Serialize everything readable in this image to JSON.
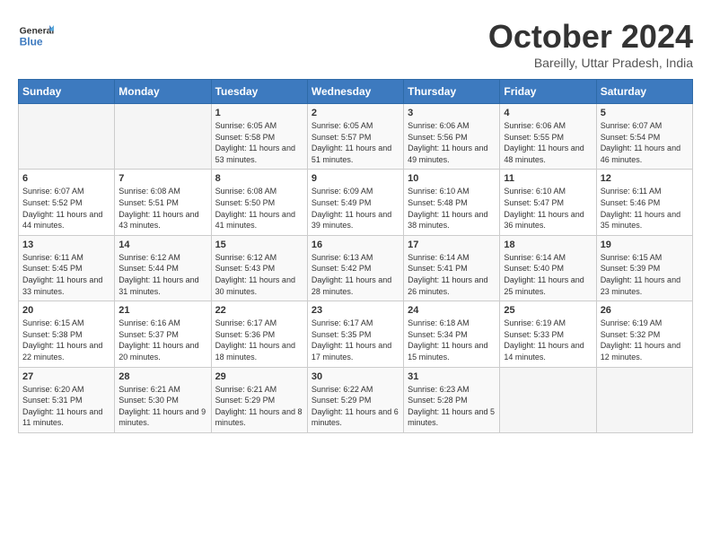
{
  "header": {
    "logo_text_general": "General",
    "logo_text_blue": "Blue",
    "month_title": "October 2024",
    "subtitle": "Bareilly, Uttar Pradesh, India"
  },
  "days_of_week": [
    "Sunday",
    "Monday",
    "Tuesday",
    "Wednesday",
    "Thursday",
    "Friday",
    "Saturday"
  ],
  "weeks": [
    [
      {
        "day": "",
        "sunrise": "",
        "sunset": "",
        "daylight": ""
      },
      {
        "day": "",
        "sunrise": "",
        "sunset": "",
        "daylight": ""
      },
      {
        "day": "1",
        "sunrise": "Sunrise: 6:05 AM",
        "sunset": "Sunset: 5:58 PM",
        "daylight": "Daylight: 11 hours and 53 minutes."
      },
      {
        "day": "2",
        "sunrise": "Sunrise: 6:05 AM",
        "sunset": "Sunset: 5:57 PM",
        "daylight": "Daylight: 11 hours and 51 minutes."
      },
      {
        "day": "3",
        "sunrise": "Sunrise: 6:06 AM",
        "sunset": "Sunset: 5:56 PM",
        "daylight": "Daylight: 11 hours and 49 minutes."
      },
      {
        "day": "4",
        "sunrise": "Sunrise: 6:06 AM",
        "sunset": "Sunset: 5:55 PM",
        "daylight": "Daylight: 11 hours and 48 minutes."
      },
      {
        "day": "5",
        "sunrise": "Sunrise: 6:07 AM",
        "sunset": "Sunset: 5:54 PM",
        "daylight": "Daylight: 11 hours and 46 minutes."
      }
    ],
    [
      {
        "day": "6",
        "sunrise": "Sunrise: 6:07 AM",
        "sunset": "Sunset: 5:52 PM",
        "daylight": "Daylight: 11 hours and 44 minutes."
      },
      {
        "day": "7",
        "sunrise": "Sunrise: 6:08 AM",
        "sunset": "Sunset: 5:51 PM",
        "daylight": "Daylight: 11 hours and 43 minutes."
      },
      {
        "day": "8",
        "sunrise": "Sunrise: 6:08 AM",
        "sunset": "Sunset: 5:50 PM",
        "daylight": "Daylight: 11 hours and 41 minutes."
      },
      {
        "day": "9",
        "sunrise": "Sunrise: 6:09 AM",
        "sunset": "Sunset: 5:49 PM",
        "daylight": "Daylight: 11 hours and 39 minutes."
      },
      {
        "day": "10",
        "sunrise": "Sunrise: 6:10 AM",
        "sunset": "Sunset: 5:48 PM",
        "daylight": "Daylight: 11 hours and 38 minutes."
      },
      {
        "day": "11",
        "sunrise": "Sunrise: 6:10 AM",
        "sunset": "Sunset: 5:47 PM",
        "daylight": "Daylight: 11 hours and 36 minutes."
      },
      {
        "day": "12",
        "sunrise": "Sunrise: 6:11 AM",
        "sunset": "Sunset: 5:46 PM",
        "daylight": "Daylight: 11 hours and 35 minutes."
      }
    ],
    [
      {
        "day": "13",
        "sunrise": "Sunrise: 6:11 AM",
        "sunset": "Sunset: 5:45 PM",
        "daylight": "Daylight: 11 hours and 33 minutes."
      },
      {
        "day": "14",
        "sunrise": "Sunrise: 6:12 AM",
        "sunset": "Sunset: 5:44 PM",
        "daylight": "Daylight: 11 hours and 31 minutes."
      },
      {
        "day": "15",
        "sunrise": "Sunrise: 6:12 AM",
        "sunset": "Sunset: 5:43 PM",
        "daylight": "Daylight: 11 hours and 30 minutes."
      },
      {
        "day": "16",
        "sunrise": "Sunrise: 6:13 AM",
        "sunset": "Sunset: 5:42 PM",
        "daylight": "Daylight: 11 hours and 28 minutes."
      },
      {
        "day": "17",
        "sunrise": "Sunrise: 6:14 AM",
        "sunset": "Sunset: 5:41 PM",
        "daylight": "Daylight: 11 hours and 26 minutes."
      },
      {
        "day": "18",
        "sunrise": "Sunrise: 6:14 AM",
        "sunset": "Sunset: 5:40 PM",
        "daylight": "Daylight: 11 hours and 25 minutes."
      },
      {
        "day": "19",
        "sunrise": "Sunrise: 6:15 AM",
        "sunset": "Sunset: 5:39 PM",
        "daylight": "Daylight: 11 hours and 23 minutes."
      }
    ],
    [
      {
        "day": "20",
        "sunrise": "Sunrise: 6:15 AM",
        "sunset": "Sunset: 5:38 PM",
        "daylight": "Daylight: 11 hours and 22 minutes."
      },
      {
        "day": "21",
        "sunrise": "Sunrise: 6:16 AM",
        "sunset": "Sunset: 5:37 PM",
        "daylight": "Daylight: 11 hours and 20 minutes."
      },
      {
        "day": "22",
        "sunrise": "Sunrise: 6:17 AM",
        "sunset": "Sunset: 5:36 PM",
        "daylight": "Daylight: 11 hours and 18 minutes."
      },
      {
        "day": "23",
        "sunrise": "Sunrise: 6:17 AM",
        "sunset": "Sunset: 5:35 PM",
        "daylight": "Daylight: 11 hours and 17 minutes."
      },
      {
        "day": "24",
        "sunrise": "Sunrise: 6:18 AM",
        "sunset": "Sunset: 5:34 PM",
        "daylight": "Daylight: 11 hours and 15 minutes."
      },
      {
        "day": "25",
        "sunrise": "Sunrise: 6:19 AM",
        "sunset": "Sunset: 5:33 PM",
        "daylight": "Daylight: 11 hours and 14 minutes."
      },
      {
        "day": "26",
        "sunrise": "Sunrise: 6:19 AM",
        "sunset": "Sunset: 5:32 PM",
        "daylight": "Daylight: 11 hours and 12 minutes."
      }
    ],
    [
      {
        "day": "27",
        "sunrise": "Sunrise: 6:20 AM",
        "sunset": "Sunset: 5:31 PM",
        "daylight": "Daylight: 11 hours and 11 minutes."
      },
      {
        "day": "28",
        "sunrise": "Sunrise: 6:21 AM",
        "sunset": "Sunset: 5:30 PM",
        "daylight": "Daylight: 11 hours and 9 minutes."
      },
      {
        "day": "29",
        "sunrise": "Sunrise: 6:21 AM",
        "sunset": "Sunset: 5:29 PM",
        "daylight": "Daylight: 11 hours and 8 minutes."
      },
      {
        "day": "30",
        "sunrise": "Sunrise: 6:22 AM",
        "sunset": "Sunset: 5:29 PM",
        "daylight": "Daylight: 11 hours and 6 minutes."
      },
      {
        "day": "31",
        "sunrise": "Sunrise: 6:23 AM",
        "sunset": "Sunset: 5:28 PM",
        "daylight": "Daylight: 11 hours and 5 minutes."
      },
      {
        "day": "",
        "sunrise": "",
        "sunset": "",
        "daylight": ""
      },
      {
        "day": "",
        "sunrise": "",
        "sunset": "",
        "daylight": ""
      }
    ]
  ]
}
